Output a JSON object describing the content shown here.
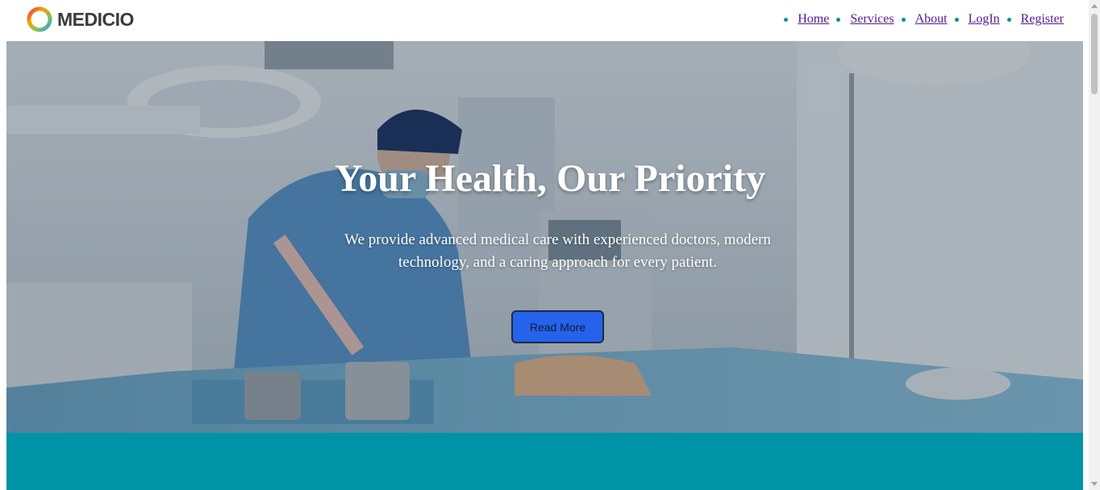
{
  "brand": {
    "name": "MEDICIO",
    "logo_icon": "circle-gradient-icon"
  },
  "nav": {
    "items": [
      {
        "label": "Home"
      },
      {
        "label": "Services"
      },
      {
        "label": "About"
      },
      {
        "label": "LogIn"
      },
      {
        "label": "Register"
      }
    ]
  },
  "hero": {
    "title": "Your Health, Our Priority",
    "description": "We provide advanced medical care with experienced doctors, modern technology, and a caring approach for every patient.",
    "button_label": "Read More"
  },
  "colors": {
    "accent": "#0b8f97",
    "band": "#0093a6",
    "button": "#2563eb",
    "link": "#551a8b"
  }
}
